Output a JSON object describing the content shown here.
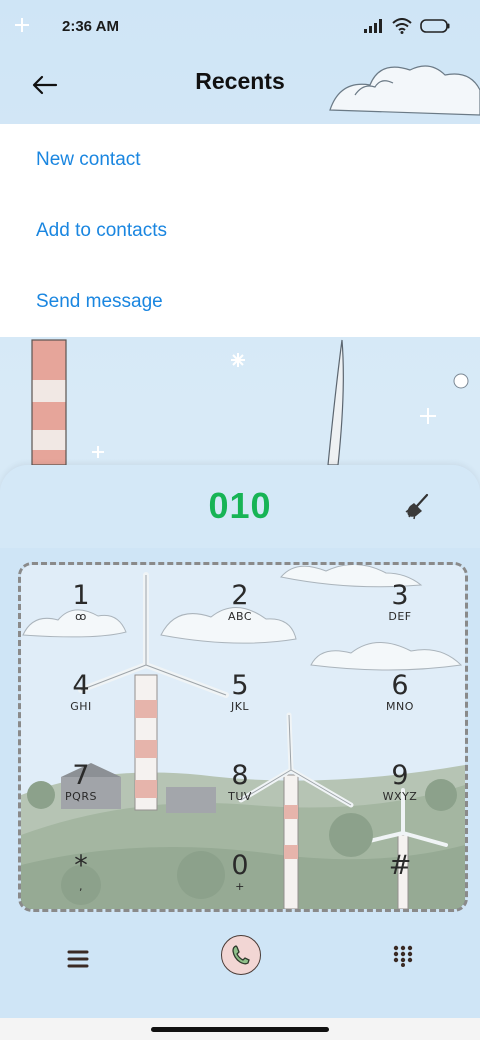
{
  "status_bar": {
    "time": "2:36 AM"
  },
  "header": {
    "title": "Recents"
  },
  "menu": {
    "items": [
      {
        "label": "New contact"
      },
      {
        "label": "Add to contacts"
      },
      {
        "label": "Send message"
      }
    ]
  },
  "dialer": {
    "number": "010",
    "keys": [
      {
        "digit": "1",
        "letters": "ꝏ"
      },
      {
        "digit": "2",
        "letters": "ABC"
      },
      {
        "digit": "3",
        "letters": "DEF"
      },
      {
        "digit": "4",
        "letters": "GHI"
      },
      {
        "digit": "5",
        "letters": "JKL"
      },
      {
        "digit": "6",
        "letters": "MNO"
      },
      {
        "digit": "7",
        "letters": "PQRS"
      },
      {
        "digit": "8",
        "letters": "TUV"
      },
      {
        "digit": "9",
        "letters": "WXYZ"
      },
      {
        "digit": "*",
        "letters": ","
      },
      {
        "digit": "0",
        "letters": "+"
      },
      {
        "digit": "#",
        "letters": ""
      }
    ]
  },
  "colors": {
    "accent": "#1a86e0",
    "number": "#17b455",
    "call_button": "#f2d6d4"
  },
  "icons": {
    "back": "arrow-left-icon",
    "clear": "broom-icon",
    "menu": "hamburger-icon",
    "call": "phone-icon",
    "keypad": "dialpad-icon"
  }
}
